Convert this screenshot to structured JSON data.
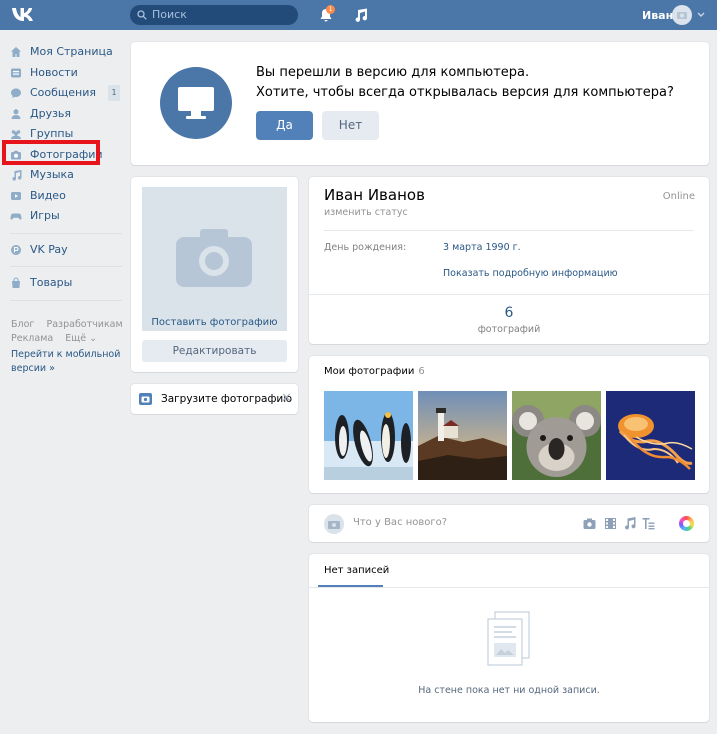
{
  "header": {
    "search_placeholder": "Поиск",
    "notification_count": "1",
    "user_name": "Иван"
  },
  "sidebar": {
    "items": [
      {
        "label": "Моя Страница",
        "icon": "home-icon"
      },
      {
        "label": "Новости",
        "icon": "news-icon"
      },
      {
        "label": "Сообщения",
        "icon": "messages-icon",
        "badge": "1"
      },
      {
        "label": "Друзья",
        "icon": "friends-icon"
      },
      {
        "label": "Группы",
        "icon": "groups-icon"
      },
      {
        "label": "Фотографии",
        "icon": "camera-icon",
        "highlighted": true
      },
      {
        "label": "Музыка",
        "icon": "music-icon"
      },
      {
        "label": "Видео",
        "icon": "video-icon"
      },
      {
        "label": "Игры",
        "icon": "games-icon"
      }
    ],
    "vkpay": "VK Pay",
    "goods": "Товары",
    "footer": {
      "blog": "Блог",
      "developers": "Разработчикам",
      "ads": "Реклама",
      "more": "Ещё",
      "mobile_line1": "Перейти к мобильной",
      "mobile_line2": "версии »"
    }
  },
  "banner": {
    "line1": "Вы перешли в версию для компьютера.",
    "line2": "Хотите, чтобы всегда открывалась версия для компьютера?",
    "yes": "Да",
    "no": "Нет"
  },
  "avatar_block": {
    "set_photo": "Поставить фотографию",
    "edit": "Редактировать",
    "upload": "Загрузите фотографию"
  },
  "profile": {
    "name": "Иван Иванов",
    "online": "Online",
    "change_status": "изменить статус",
    "birthday_label": "День рождения:",
    "birthday_value": "3 марта 1990 г.",
    "show_more": "Показать подробную информацию",
    "photo_count": "6",
    "photo_count_label": "фотографий"
  },
  "photos": {
    "title": "Мои фотографии",
    "count": "6"
  },
  "post": {
    "placeholder": "Что у Вас нового?"
  },
  "wall": {
    "tab": "Нет записей",
    "empty": "На стене пока нет ни одной записи."
  },
  "colors": {
    "header": "#4a76a8",
    "link": "#2a5885",
    "highlight": "#e8141c",
    "button_primary": "#5181b8"
  }
}
